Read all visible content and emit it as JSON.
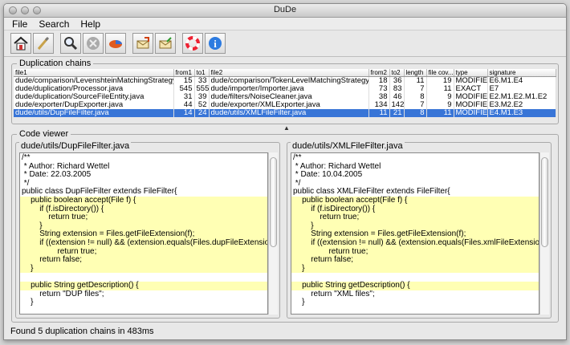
{
  "window": {
    "title": "DuDe"
  },
  "menu": [
    "File",
    "Search",
    "Help"
  ],
  "toolbar": {
    "icons": [
      "home-icon",
      "brush-icon",
      "magnifier-icon",
      "stop-icon",
      "pie-icon",
      "mail-out-icon",
      "mail-in-icon",
      "lifebuoy-icon",
      "info-icon"
    ]
  },
  "chains": {
    "label": "Duplication chains",
    "columns": [
      "file1",
      "from1",
      "to1",
      "file2",
      "from2",
      "to2",
      "length",
      "file cov...",
      "type",
      "signature"
    ],
    "rows": [
      [
        "dude/comparison/LevenshteinMatchingStrategy.java",
        "15",
        "33",
        "dude/comparison/TokenLevelMatchingStrategy.java",
        "18",
        "36",
        "11",
        "19",
        "MODIFIED",
        "E6.M1.E4"
      ],
      [
        "dude/duplication/Processor.java",
        "545",
        "555",
        "dude/importer/Importer.java",
        "73",
        "83",
        "7",
        "11",
        "EXACT",
        "E7"
      ],
      [
        "dude/duplication/SourceFileEntity.java",
        "31",
        "39",
        "dude/filters/NoiseCleaner.java",
        "38",
        "46",
        "8",
        "9",
        "MODIFIED",
        "E2.M1.E2.M1.E2"
      ],
      [
        "dude/exporter/DupExporter.java",
        "44",
        "52",
        "dude/exporter/XMLExporter.java",
        "134",
        "142",
        "7",
        "9",
        "MODIFIED",
        "E3.M2.E2"
      ],
      [
        "dude/utils/DupFileFilter.java",
        "14",
        "24",
        "dude/utils/XMLFileFilter.java",
        "11",
        "21",
        "8",
        "11",
        "MODIFIED",
        "E4.M1.E3"
      ]
    ],
    "selected_row": 4
  },
  "code_viewer": {
    "label": "Code viewer",
    "left": {
      "title": "dude/utils/DupFileFilter.java",
      "lines": [
        {
          "t": "/**",
          "h": false
        },
        {
          "t": " * Author: Richard Wettel",
          "h": false
        },
        {
          "t": " * Date: 22.03.2005",
          "h": false
        },
        {
          "t": " */",
          "h": false
        },
        {
          "t": "public class DupFileFilter extends FileFilter{",
          "h": false
        },
        {
          "t": "    public boolean accept(File f) {",
          "h": true
        },
        {
          "t": "        if (f.isDirectory()) {",
          "h": true
        },
        {
          "t": "            return true;",
          "h": true
        },
        {
          "t": "        }",
          "h": true
        },
        {
          "t": "        String extension = Files.getFileExtension(f);",
          "h": true
        },
        {
          "t": "        if ((extension != null) && (extension.equals(Files.dupFileExtension)))",
          "h": true
        },
        {
          "t": "                return true;",
          "h": true
        },
        {
          "t": "        return false;",
          "h": true
        },
        {
          "t": "    }",
          "h": true
        },
        {
          "t": "",
          "h": false
        },
        {
          "t": "    public String getDescription() {",
          "h": true
        },
        {
          "t": "        return \"DUP files\";",
          "h": false
        },
        {
          "t": "    }",
          "h": false
        }
      ]
    },
    "right": {
      "title": "dude/utils/XMLFileFilter.java",
      "lines": [
        {
          "t": "/**",
          "h": false
        },
        {
          "t": " * Author: Richard Wettel",
          "h": false
        },
        {
          "t": " * Date: 10.04.2005",
          "h": false
        },
        {
          "t": " */",
          "h": false
        },
        {
          "t": "public class XMLFileFilter extends FileFilter{",
          "h": false
        },
        {
          "t": "    public boolean accept(File f) {",
          "h": true
        },
        {
          "t": "        if (f.isDirectory()) {",
          "h": true
        },
        {
          "t": "            return true;",
          "h": true
        },
        {
          "t": "        }",
          "h": true
        },
        {
          "t": "        String extension = Files.getFileExtension(f);",
          "h": true
        },
        {
          "t": "        if ((extension != null) && (extension.equals(Files.xmlFileExtension)))",
          "h": true
        },
        {
          "t": "                return true;",
          "h": true
        },
        {
          "t": "        return false;",
          "h": true
        },
        {
          "t": "    }",
          "h": true
        },
        {
          "t": "",
          "h": false
        },
        {
          "t": "    public String getDescription() {",
          "h": true
        },
        {
          "t": "        return \"XML files\";",
          "h": false
        },
        {
          "t": "    }",
          "h": false
        }
      ]
    }
  },
  "status": "Found 5 duplication chains in 483ms",
  "colors": {
    "selection": "#3875d7",
    "highlight": "#ffffb4"
  }
}
